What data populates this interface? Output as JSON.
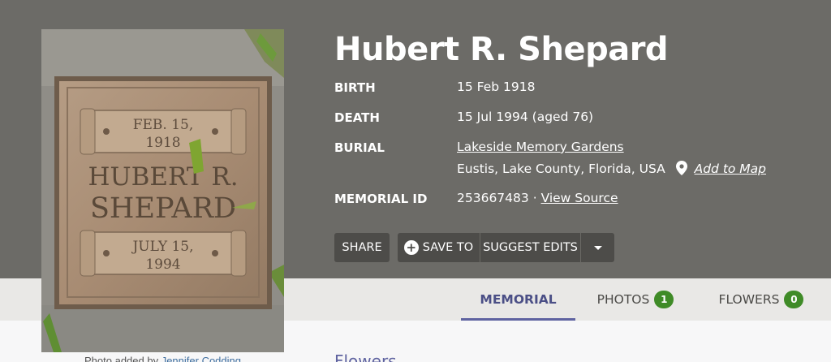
{
  "memorial": {
    "name": "Hubert R. Shepard",
    "birth_label": "BIRTH",
    "birth": "15 Feb 1918",
    "death_label": "DEATH",
    "death": "15 Jul 1994 (aged 76)",
    "burial_label": "BURIAL",
    "cemetery": "Lakeside Memory Gardens",
    "location": "Eustis, Lake County, Florida, USA",
    "add_to_map": "Add to Map",
    "memorial_id_label": "MEMORIAL ID",
    "memorial_id": "253667483",
    "id_separator": "·",
    "view_source": "View Source"
  },
  "photo": {
    "caption_prefix": "Photo added by",
    "caption_author": "Jennifer Codding",
    "plaque_birth_line1": "FEB. 15,",
    "plaque_birth_line2": "1918",
    "plaque_name_line1": "HUBERT R.",
    "plaque_name_line2": "SHEPARD",
    "plaque_death_line1": "JULY 15,",
    "plaque_death_line2": "1994"
  },
  "actions": {
    "share": "SHARE",
    "save_to": "SAVE TO",
    "suggest_edits": "SUGGEST EDITS"
  },
  "tabs": {
    "memorial": "MEMORIAL",
    "photos": "PHOTOS",
    "photos_count": "1",
    "flowers": "FLOWERS",
    "flowers_count": "0"
  },
  "sections": {
    "flowers_title": "Flowers"
  },
  "colors": {
    "hero_bg": "#6c6b67",
    "tab_active": "#5f63a0",
    "badge_green": "#3f8b27"
  }
}
